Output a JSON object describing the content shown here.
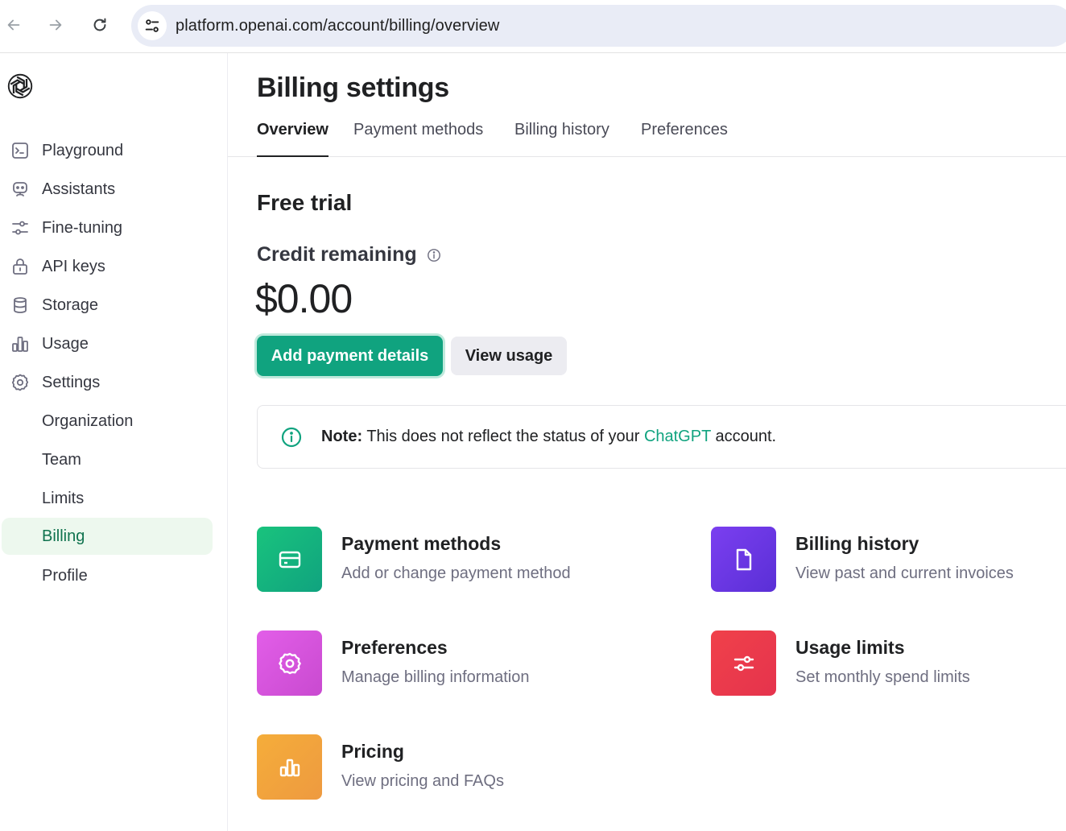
{
  "browser": {
    "url": "platform.openai.com/account/billing/overview"
  },
  "sidebar": {
    "items": [
      {
        "label": "Playground",
        "icon": "terminal-icon"
      },
      {
        "label": "Assistants",
        "icon": "robot-icon"
      },
      {
        "label": "Fine-tuning",
        "icon": "sliders-icon"
      },
      {
        "label": "API keys",
        "icon": "lock-icon"
      },
      {
        "label": "Storage",
        "icon": "database-icon"
      },
      {
        "label": "Usage",
        "icon": "bar-chart-icon"
      },
      {
        "label": "Settings",
        "icon": "gear-icon"
      }
    ],
    "subitems": [
      {
        "label": "Organization"
      },
      {
        "label": "Team"
      },
      {
        "label": "Limits"
      },
      {
        "label": "Billing",
        "active": true
      },
      {
        "label": "Profile"
      }
    ]
  },
  "main": {
    "title": "Billing settings",
    "tabs": [
      {
        "label": "Overview",
        "active": true
      },
      {
        "label": "Payment methods"
      },
      {
        "label": "Billing history"
      },
      {
        "label": "Preferences"
      }
    ],
    "plan": "Free trial",
    "credit_label": "Credit remaining",
    "credit_amount": "$0.00",
    "primary_button": "Add payment details",
    "secondary_button": "View usage",
    "note": {
      "label": "Note:",
      "text_before": "This does not reflect the status of your",
      "link": "ChatGPT",
      "text_after": "account."
    },
    "cards": [
      {
        "title": "Payment methods",
        "desc": "Add or change payment method",
        "icon": "credit-card-icon",
        "color": "#19c37d"
      },
      {
        "title": "Billing history",
        "desc": "View past and current invoices",
        "icon": "document-icon",
        "color": "#6e3ff3"
      },
      {
        "title": "Preferences",
        "desc": "Manage billing information",
        "icon": "gear-icon",
        "color": "#dd5ce5"
      },
      {
        "title": "Usage limits",
        "desc": "Set monthly spend limits",
        "icon": "sliders-icon",
        "color": "#ef4146"
      },
      {
        "title": "Pricing",
        "desc": "View pricing and FAQs",
        "icon": "bar-chart-icon",
        "color": "#f4ac36"
      }
    ]
  },
  "colors": {
    "accent": "#10a37f",
    "active_nav_bg": "#edf8ee",
    "active_nav_text": "#10734f"
  }
}
